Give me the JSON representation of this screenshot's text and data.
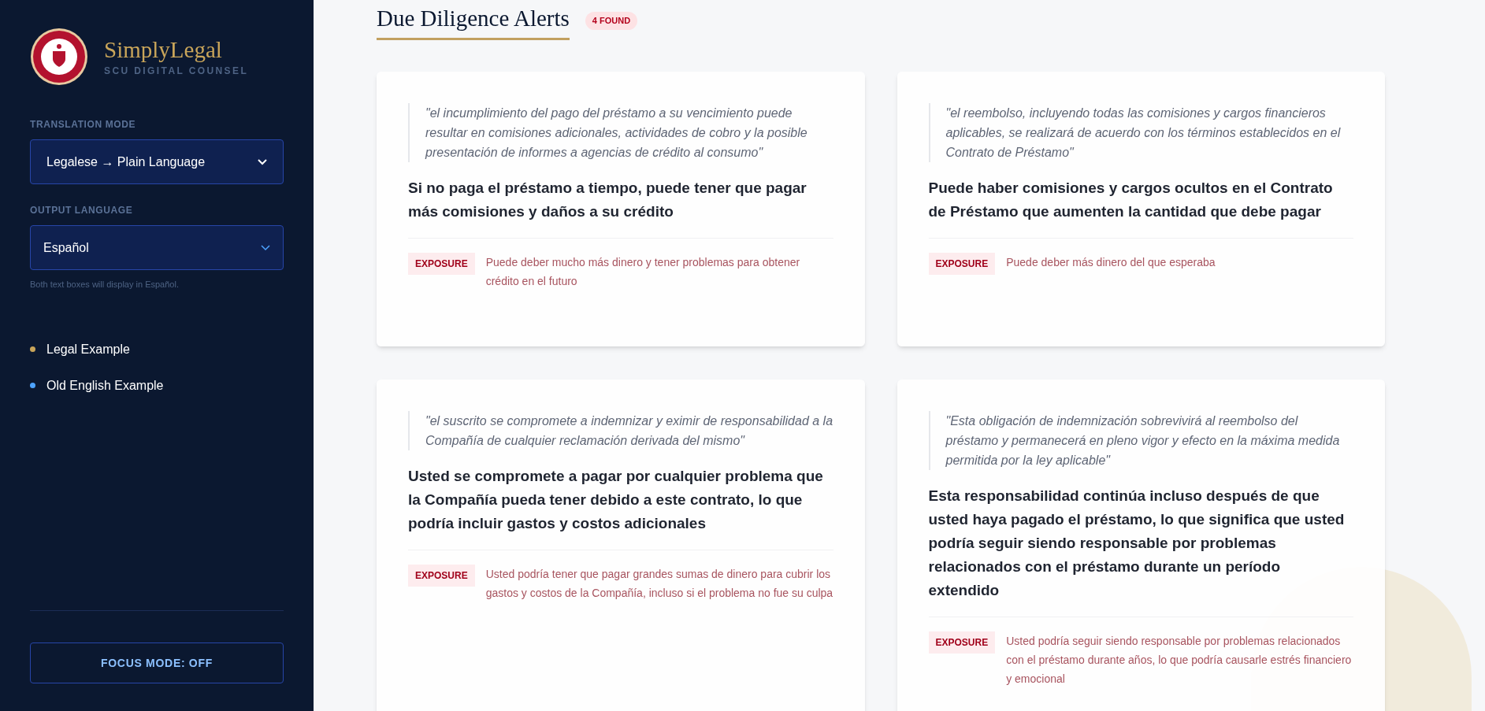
{
  "sidebar": {
    "brand": {
      "title": "SimplyLegal",
      "subtitle": "SCU DIGITAL COUNSEL"
    },
    "translation_mode": {
      "label": "TRANSLATION MODE",
      "value": "Legalese → Plain Language"
    },
    "output_language": {
      "label": "OUTPUT LANGUAGE",
      "value": "Español",
      "hint": "Both text boxes will display in Español."
    },
    "examples": [
      {
        "label": "Legal Example",
        "color": "#c9a55a"
      },
      {
        "label": "Old English Example",
        "color": "#4da3ff"
      }
    ],
    "focus_button": "FOCUS MODE: OFF"
  },
  "main": {
    "title": "Due Diligence Alerts",
    "badge": "4 FOUND",
    "alerts": [
      {
        "quote": "\"el incumplimiento del pago del préstamo a su vencimiento puede resultar en comisiones adicionales, actividades de cobro y la posible presentación de informes a agencias de crédito al consumo\"",
        "summary": "Si no paga el préstamo a tiempo, puede tener que pagar más comisiones y daños a su crédito",
        "tag": "EXPOSURE",
        "exposure": "Puede deber mucho más dinero y tener problemas para obtener crédito en el futuro"
      },
      {
        "quote": "\"el reembolso, incluyendo todas las comisiones y cargos financieros aplicables, se realizará de acuerdo con los términos establecidos en el Contrato de Préstamo\"",
        "summary": "Puede haber comisiones y cargos ocultos en el Contrato de Préstamo que aumenten la cantidad que debe pagar",
        "tag": "EXPOSURE",
        "exposure": "Puede deber más dinero del que esperaba"
      },
      {
        "quote": "\"el suscrito se compromete a indemnizar y eximir de responsabilidad a la Compañía de cualquier reclamación derivada del mismo\"",
        "summary": "Usted se compromete a pagar por cualquier problema que la Compañía pueda tener debido a este contrato, lo que podría incluir gastos y costos adicionales",
        "tag": "EXPOSURE",
        "exposure": "Usted podría tener que pagar grandes sumas de dinero para cubrir los gastos y costos de la Compañía, incluso si el problema no fue su culpa"
      },
      {
        "quote": "\"Esta obligación de indemnización sobrevivirá al reembolso del préstamo y permanecerá en pleno vigor y efecto en la máxima medida permitida por la ley aplicable\"",
        "summary": "Esta responsabilidad continúa incluso después de que usted haya pagado el préstamo, lo que significa que usted podría seguir siendo responsable por problemas relacionados con el préstamo durante un período extendido",
        "tag": "EXPOSURE",
        "exposure": "Usted podría seguir siendo responsable por problemas relacionados con el préstamo durante años, lo que podría causarle estrés financiero y emocional"
      }
    ]
  }
}
